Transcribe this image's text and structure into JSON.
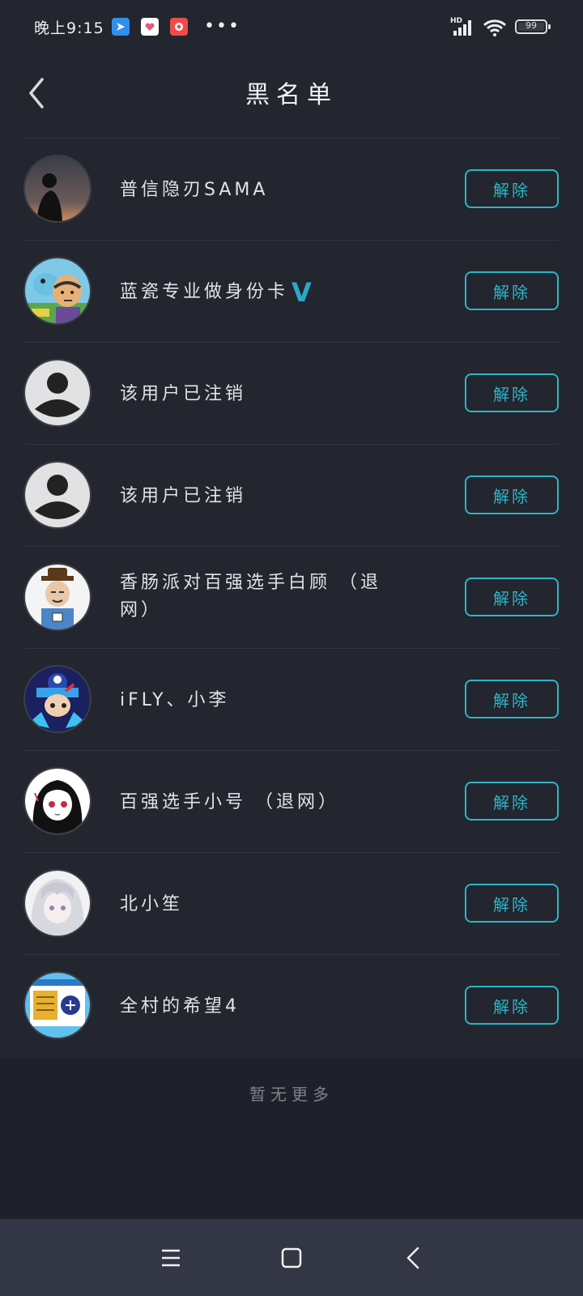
{
  "status_bar": {
    "time": "晚上9:15",
    "app_icons": [
      "message-icon",
      "heart-app-icon",
      "red-app-icon"
    ],
    "more": "•••",
    "network": "HD",
    "battery": "99",
    "battery_level": 0.99
  },
  "header": {
    "title": "黑名单",
    "back_icon": "chevron-left-icon"
  },
  "blacklist": {
    "remove_label": "解除",
    "items": [
      {
        "name": "普信隐刃SAMA",
        "verified": false,
        "avatar": "silhouette-sunset"
      },
      {
        "name": "蓝瓷专业做身份卡",
        "verified": true,
        "avatar": "cartoon-dino"
      },
      {
        "name": "该用户已注销",
        "verified": false,
        "avatar": "default-user"
      },
      {
        "name": "该用户已注销",
        "verified": false,
        "avatar": "default-user"
      },
      {
        "name": "香肠派对百强选手白顾 （退网）",
        "verified": false,
        "avatar": "old-man-cartoon"
      },
      {
        "name": "iFLY、小李",
        "verified": false,
        "avatar": "game-character"
      },
      {
        "name": "百强选手小号 （退网）",
        "verified": false,
        "avatar": "anime-girl-bw"
      },
      {
        "name": "北小笙",
        "verified": false,
        "avatar": "anime-white-hair"
      },
      {
        "name": "全村的希望4",
        "verified": false,
        "avatar": "game-card"
      }
    ]
  },
  "footer": {
    "no_more": "暂无更多"
  },
  "verify_mark": "V",
  "nav": {
    "menu": "menu-icon",
    "home": "square-home-icon",
    "back": "back-icon"
  },
  "colors": {
    "background": "#23252f",
    "accent": "#2bb6c8",
    "text": "#e6e7eb"
  }
}
